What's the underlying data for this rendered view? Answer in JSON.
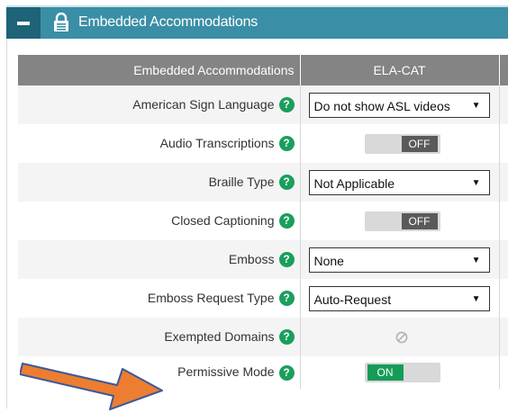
{
  "section": {
    "title": "Embedded Accommodations"
  },
  "table": {
    "headers": [
      "Embedded Accommodations",
      "ELA-CAT"
    ],
    "rows": [
      {
        "label": "American Sign Language",
        "type": "select",
        "value": "Do not show ASL videos"
      },
      {
        "label": "Audio Transcriptions",
        "type": "toggle",
        "value": "OFF"
      },
      {
        "label": "Braille Type",
        "type": "select",
        "value": "Not Applicable"
      },
      {
        "label": "Closed Captioning",
        "type": "toggle",
        "value": "OFF"
      },
      {
        "label": "Emboss",
        "type": "select",
        "value": "None"
      },
      {
        "label": "Emboss Request Type",
        "type": "select",
        "value": "Auto-Request"
      },
      {
        "label": "Exempted Domains",
        "type": "disabled",
        "value": ""
      },
      {
        "label": "Permissive Mode",
        "type": "toggle",
        "value": "ON"
      }
    ]
  },
  "help_glyph": "?",
  "select_arrow": "▼",
  "icons": {
    "collapse": "minus-icon",
    "section": "lock-icon",
    "help": "question-circle-icon",
    "disabled": "ban-icon",
    "annotation": "arrow-annotation"
  },
  "colors": {
    "header_bg": "#3a8fa6",
    "collapse_bg": "#1f6378",
    "table_header_bg": "#848484",
    "help_green": "#1a9f5c",
    "toggle_on": "#169c59",
    "toggle_off": "#5a5a5a",
    "arrow_fill": "#ed7d31",
    "arrow_stroke": "#3b5998"
  }
}
